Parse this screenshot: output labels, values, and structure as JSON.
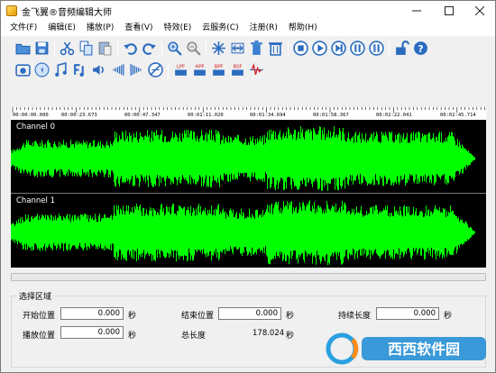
{
  "window": {
    "title": "金飞翼®音频编辑大师"
  },
  "menu": [
    "文件(F)",
    "编辑(E)",
    "播放(P)",
    "查看(V)",
    "特效(E)",
    "云服务(C)",
    "注册(R)",
    "帮助(H)"
  ],
  "toolbar1": [
    "open-folder-icon",
    "save-icon",
    "cut-icon",
    "copy-icon",
    "paste-icon",
    "undo-icon",
    "redo-icon",
    "zoom-in-icon",
    "zoom-out-icon",
    "select-all-icon",
    "trim-icon",
    "delete-icon",
    "insert-silence-icon",
    "stop-icon",
    "play-icon",
    "loop-play-icon",
    "pause-icon",
    "record-icon",
    "lock-icon",
    "help-icon"
  ],
  "toolbar2": [
    "noise-reduction-icon",
    "silence-icon",
    "music-note-icon",
    "normalize-icon",
    "volume-icon",
    "fade-in-icon",
    "fade-out-icon",
    "reverse-icon",
    "lpf-icon",
    "hpf-icon",
    "bpf-icon",
    "bsf-icon",
    "equalizer-icon"
  ],
  "ruler": {
    "ticks": [
      "00:00:00.000",
      "00:00:23.673",
      "00:00:47.347",
      "00:01:11.020",
      "00:01:34.694",
      "00:01:58.367",
      "00:02:22.041",
      "00:02:45.714"
    ]
  },
  "channels": [
    {
      "label": "Channel 0"
    },
    {
      "label": "Channel 1"
    }
  ],
  "colors": {
    "waveform": "#00ff00",
    "background": "#000000"
  },
  "selection": {
    "title": "选择区域",
    "start_label": "开始位置",
    "start_value": "0.000",
    "end_label": "结束位置",
    "end_value": "0.000",
    "length_label": "持续长度",
    "length_value": "0.000",
    "play_label": "播放位置",
    "play_value": "0.000",
    "total_label": "总长度",
    "total_value": "178.024",
    "unit": "秒"
  },
  "watermark": {
    "text": "西西软件园"
  }
}
